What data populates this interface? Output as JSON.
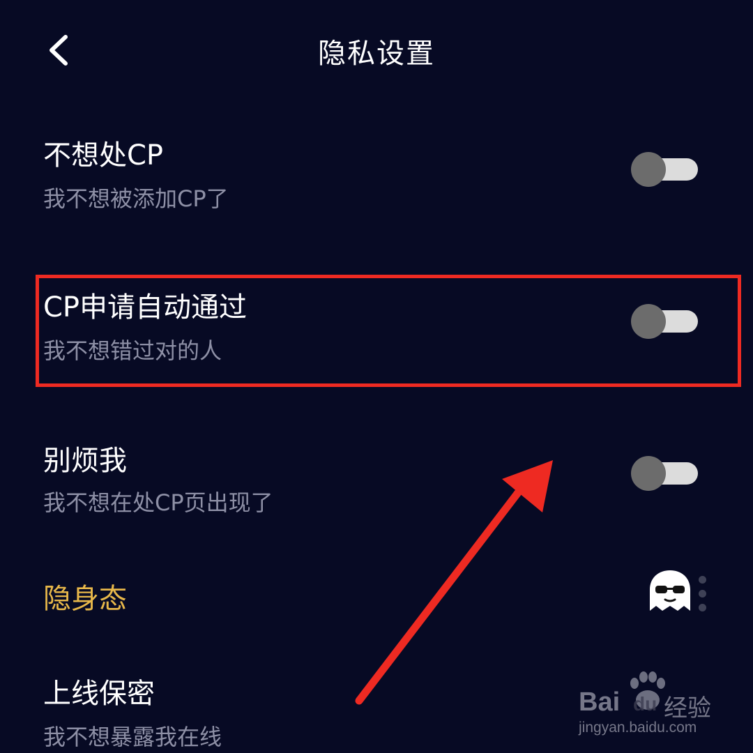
{
  "header": {
    "title": "隐私设置",
    "back_icon": "chevron-left-icon"
  },
  "settings": [
    {
      "title": "不想处CP",
      "subtitle": "我不想被添加CP了",
      "toggle_on": false
    },
    {
      "title": "CP申请自动通过",
      "subtitle": "我不想错过对的人",
      "toggle_on": false
    },
    {
      "title": "别烦我",
      "subtitle": "我不想在处CP页出现了",
      "toggle_on": false
    },
    {
      "title": "隐身态",
      "subtitle": "",
      "icon": "ghost-sunglasses-icon"
    },
    {
      "title": "上线保密",
      "subtitle": "我不想暴露我在线"
    }
  ],
  "colors": {
    "background": "#070a24",
    "gold_label": "#e8b84a",
    "annotation_red": "#ee2a22",
    "toggle_track": "#dcdcdc",
    "toggle_knob": "#6c6c6c"
  },
  "watermark": {
    "brand": "Bai",
    "brand_suffix": "du",
    "brand_cn": "经验",
    "url": "jingyan.baidu.com"
  }
}
